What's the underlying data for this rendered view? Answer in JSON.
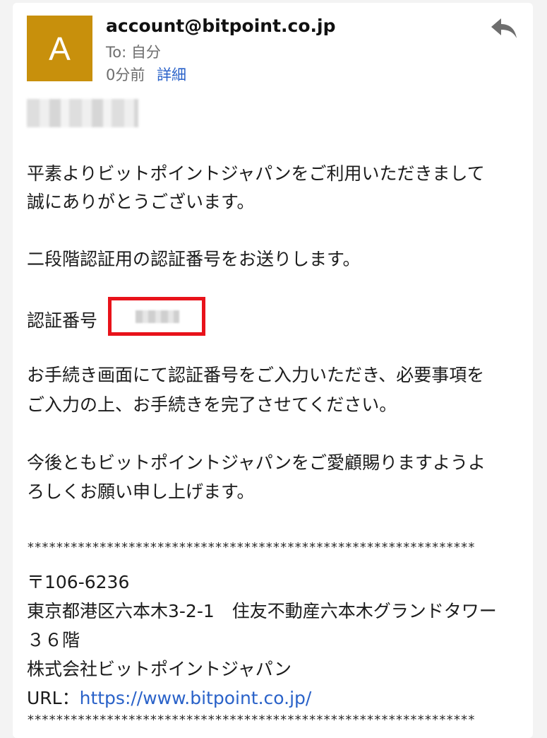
{
  "header": {
    "avatar_letter": "A",
    "sender": "account@bitpoint.co.jp",
    "to": "To: 自分",
    "time": "0分前",
    "details_link": "詳細"
  },
  "icons": {
    "reply": "reply-arrow-icon"
  },
  "body": {
    "p1_line1": "平素よりビットポイントジャパンをご利用いただきまして",
    "p1_line2": "誠にありがとうございます。",
    "p2": "二段階認証用の認証番号をお送りします。",
    "code_label": "認証番号",
    "p3_line1": "お手続き画面にて認証番号をご入力いただき、必要事項を",
    "p3_line2": "ご入力の上、お手続きを完了させてください。",
    "p4_line1": "今後ともビットポイントジャパンをご愛顧賜りますようよ",
    "p4_line2": "ろしくお願い申し上げます。"
  },
  "footer": {
    "separator": "**************************************************************",
    "postal": "〒106-6236",
    "address_line1": "東京都港区六本木3-2-1　住友不動産六本木グランドタワー",
    "address_line2": "３６階",
    "company": "株式会社ビットポイントジャパン",
    "url_label": "URL：",
    "url": "https://www.bitpoint.co.jp/"
  },
  "colors": {
    "avatar": "#c8900c",
    "link": "#2a62c9",
    "highlight_box": "#e8121a"
  }
}
